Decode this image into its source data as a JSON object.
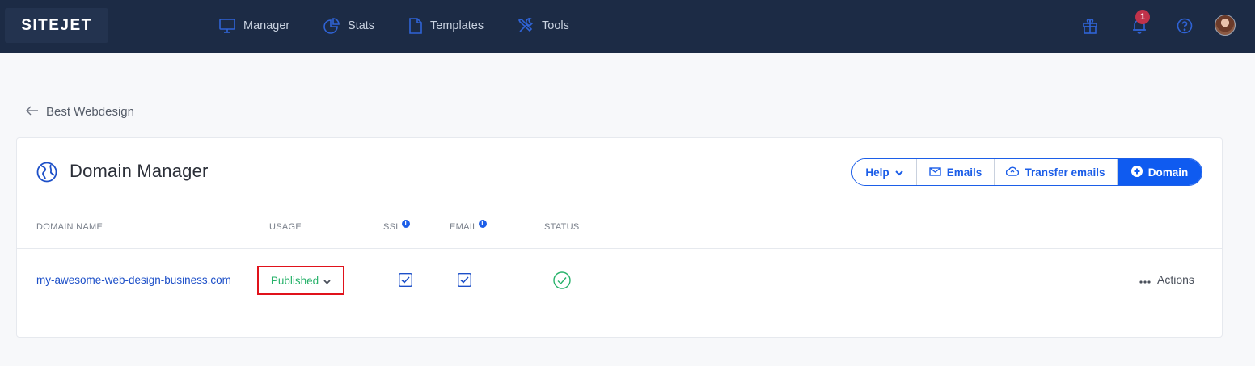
{
  "app": {
    "logo_text": "SITEJET"
  },
  "nav": {
    "items": [
      {
        "label": "Manager",
        "icon": "monitor-icon"
      },
      {
        "label": "Stats",
        "icon": "pie-chart-icon"
      },
      {
        "label": "Templates",
        "icon": "document-icon"
      },
      {
        "label": "Tools",
        "icon": "tools-icon"
      }
    ],
    "right": {
      "notification_count": "1"
    }
  },
  "breadcrumb": {
    "back_label": "Best Webdesign"
  },
  "card": {
    "title": "Domain Manager",
    "buttons": {
      "help": "Help",
      "emails": "Emails",
      "transfer": "Transfer emails",
      "domain": "Domain"
    },
    "table": {
      "headers": {
        "domain_name": "DOMAIN NAME",
        "usage": "USAGE",
        "ssl": "SSL",
        "email": "EMAIL",
        "status": "STATUS"
      },
      "rows": [
        {
          "domain": "my-awesome-web-design-business.com",
          "usage": "Published",
          "ssl": true,
          "email": true,
          "status": "ok",
          "actions_label": "Actions"
        }
      ]
    }
  },
  "colors": {
    "nav_bg": "#1c2b45",
    "accent": "#0f5bf0",
    "link": "#1c4fc8",
    "published": "#27b26a",
    "highlight_box": "#e0121b",
    "badge": "#c0324a"
  }
}
